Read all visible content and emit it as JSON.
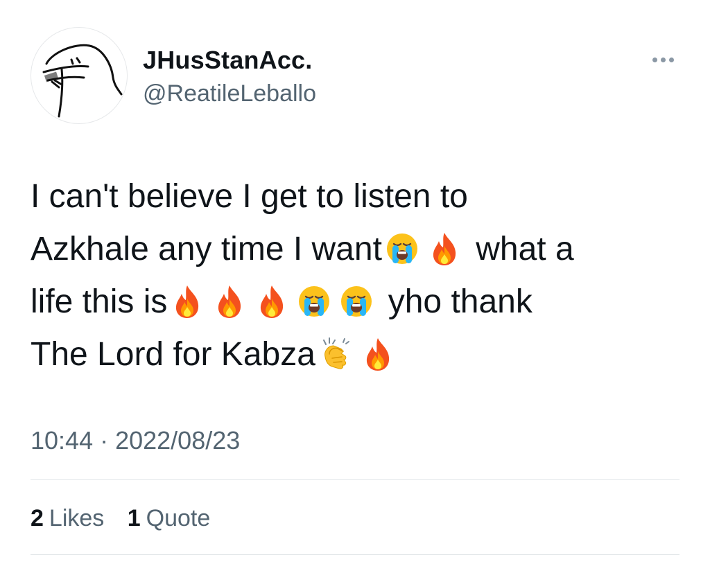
{
  "user": {
    "display_name": "JHusStanAcc.",
    "handle": "@ReatileLeballo"
  },
  "tweet": {
    "lines": [
      {
        "segments": [
          {
            "type": "text",
            "value": "I can't believe I get to listen to"
          }
        ]
      },
      {
        "segments": [
          {
            "type": "text",
            "value": "Azkhale any time I want"
          },
          {
            "type": "emoji",
            "icon": "loudly-crying-face-icon"
          },
          {
            "type": "emoji",
            "icon": "fire-icon"
          },
          {
            "type": "text",
            "value": " what a"
          }
        ]
      },
      {
        "segments": [
          {
            "type": "text",
            "value": "life this is"
          },
          {
            "type": "emoji",
            "icon": "fire-icon"
          },
          {
            "type": "emoji",
            "icon": "fire-icon"
          },
          {
            "type": "emoji",
            "icon": "fire-icon"
          },
          {
            "type": "emoji",
            "icon": "loudly-crying-face-icon"
          },
          {
            "type": "emoji",
            "icon": "loudly-crying-face-icon"
          },
          {
            "type": "text",
            "value": " yho thank"
          }
        ]
      },
      {
        "segments": [
          {
            "type": "text",
            "value": "The Lord for Kabza"
          },
          {
            "type": "emoji",
            "icon": "clapping-hands-icon"
          },
          {
            "type": "emoji",
            "icon": "fire-icon"
          }
        ]
      }
    ],
    "timestamp": "10:44 · 2022/08/23"
  },
  "stats": {
    "likes_count": "2",
    "likes_label": "Likes",
    "quotes_count": "1",
    "quotes_label": "Quote"
  },
  "colors": {
    "text": "#0f1419",
    "secondary": "#536471",
    "divider": "#e1e5e8"
  }
}
